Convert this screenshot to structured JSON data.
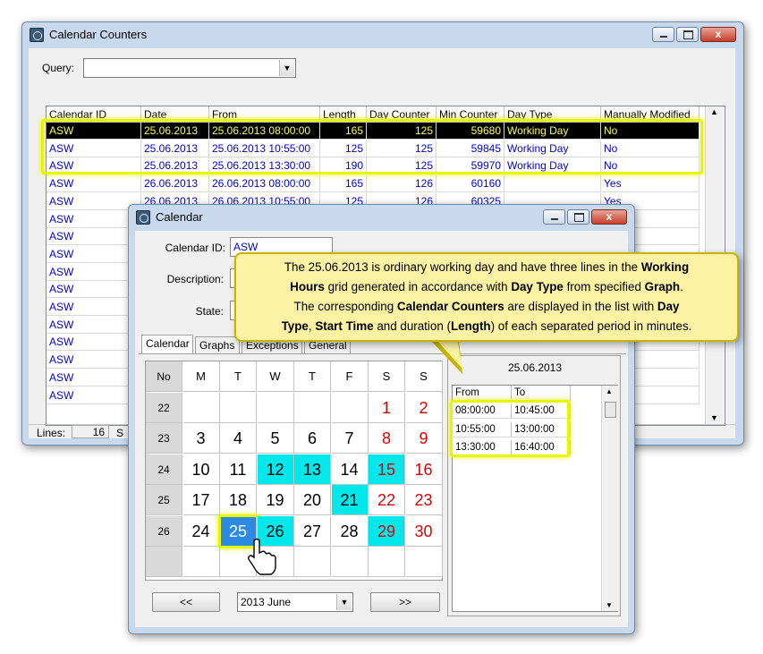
{
  "main_window": {
    "title": "Calendar Counters",
    "close_glyph": "x",
    "query_label": "Query:",
    "query_value": "",
    "columns": [
      "Calendar ID",
      "Date",
      "From",
      "Length",
      "Day Counter",
      "Min Counter",
      "Day Type",
      "Manually Modified"
    ],
    "rows": [
      [
        "ASW",
        "25.06.2013",
        "25.06.2013 08:00:00",
        "165",
        "125",
        "59680",
        "Working Day",
        "No"
      ],
      [
        "ASW",
        "25.06.2013",
        "25.06.2013 10:55:00",
        "125",
        "125",
        "59845",
        "Working Day",
        "No"
      ],
      [
        "ASW",
        "25.06.2013",
        "25.06.2013 13:30:00",
        "190",
        "125",
        "59970",
        "Working Day",
        "No"
      ],
      [
        "ASW",
        "26.06.2013",
        "26.06.2013 08:00:00",
        "165",
        "126",
        "60160",
        "",
        "Yes"
      ],
      [
        "ASW",
        "26.06.2013",
        "26.06.2013 10:55:00",
        "125",
        "126",
        "60325",
        "",
        "Yes"
      ],
      [
        "ASW",
        "",
        "",
        "",
        "",
        "",
        "",
        ""
      ],
      [
        "ASW",
        "",
        "",
        "",
        "",
        "",
        "",
        ""
      ],
      [
        "ASW",
        "",
        "",
        "",
        "",
        "",
        "",
        ""
      ],
      [
        "ASW",
        "",
        "",
        "",
        "",
        "",
        "",
        ""
      ],
      [
        "ASW",
        "",
        "",
        "",
        "",
        "",
        "",
        ""
      ],
      [
        "ASW",
        "",
        "",
        "",
        "",
        "",
        "",
        ""
      ],
      [
        "ASW",
        "",
        "",
        "",
        "",
        "",
        "",
        ""
      ],
      [
        "ASW",
        "",
        "",
        "",
        "",
        "",
        "",
        ""
      ],
      [
        "ASW",
        "",
        "",
        "",
        "",
        "",
        "",
        ""
      ],
      [
        "ASW",
        "",
        "",
        "",
        "",
        "",
        "",
        ""
      ],
      [
        "ASW",
        "",
        "",
        "",
        "",
        "",
        "",
        ""
      ]
    ],
    "selected_row": 0,
    "status_lines_label": "Lines:",
    "status_lines_value": "16",
    "status_extra": "S"
  },
  "calendar_window": {
    "title": "Calendar",
    "close_glyph": "x",
    "calendar_id_label": "Calendar ID:",
    "calendar_id_value": "ASW",
    "description_label": "Description:",
    "state_label": "State:",
    "tabs": [
      "Calendar",
      "Graphs",
      "Exceptions",
      "General"
    ],
    "active_tab": "Calendar",
    "weekday_headers": [
      "No",
      "M",
      "T",
      "W",
      "T",
      "F",
      "S",
      "S"
    ],
    "weeks": [
      {
        "no": "22",
        "days": [
          "",
          "",
          "",
          "",
          "",
          "1",
          "2"
        ]
      },
      {
        "no": "23",
        "days": [
          "3",
          "4",
          "5",
          "6",
          "7",
          "8",
          "9"
        ]
      },
      {
        "no": "24",
        "days": [
          "10",
          "11",
          "12",
          "13",
          "14",
          "15",
          "16"
        ]
      },
      {
        "no": "25",
        "days": [
          "17",
          "18",
          "19",
          "20",
          "21",
          "22",
          "23"
        ]
      },
      {
        "no": "26",
        "days": [
          "24",
          "25",
          "26",
          "27",
          "28",
          "29",
          "30"
        ]
      },
      {
        "no": "",
        "days": [
          "",
          "",
          "",
          "",
          "",
          "",
          ""
        ]
      }
    ],
    "prev_button": "<<",
    "next_button": ">>",
    "month_select": "2013 June",
    "hours_date": "25.06.2013",
    "hours_columns": [
      "From",
      "To"
    ],
    "hours_rows": [
      [
        "08:00:00",
        "10:45:00"
      ],
      [
        "10:55:00",
        "13:00:00"
      ],
      [
        "13:30:00",
        "16:40:00"
      ]
    ],
    "colors": {
      "working_highlight": "#00e8ec",
      "today": "#2d8ae2",
      "weekend": "#e00000",
      "glow": "#e8f500"
    }
  },
  "callout": {
    "line1_a": "The 25.06.2013 is ordinary working day and have three lines in the ",
    "line1_b": "Working",
    "line2_a": "Hours",
    "line2_b": " grid generated in accordance with ",
    "line2_c": "Day Type",
    "line2_d": " from specified ",
    "line2_e": "Graph",
    "line2_f": ".",
    "line3_a": "The corresponding ",
    "line3_b": "Calendar Counters",
    "line3_c": " are displayed in the list with ",
    "line3_d": "Day",
    "line4_a": "Type",
    "line4_b": ", ",
    "line4_c": "Start Time",
    "line4_d": " and duration (",
    "line4_e": "Length",
    "line4_f": ") of each separated period in minutes."
  }
}
